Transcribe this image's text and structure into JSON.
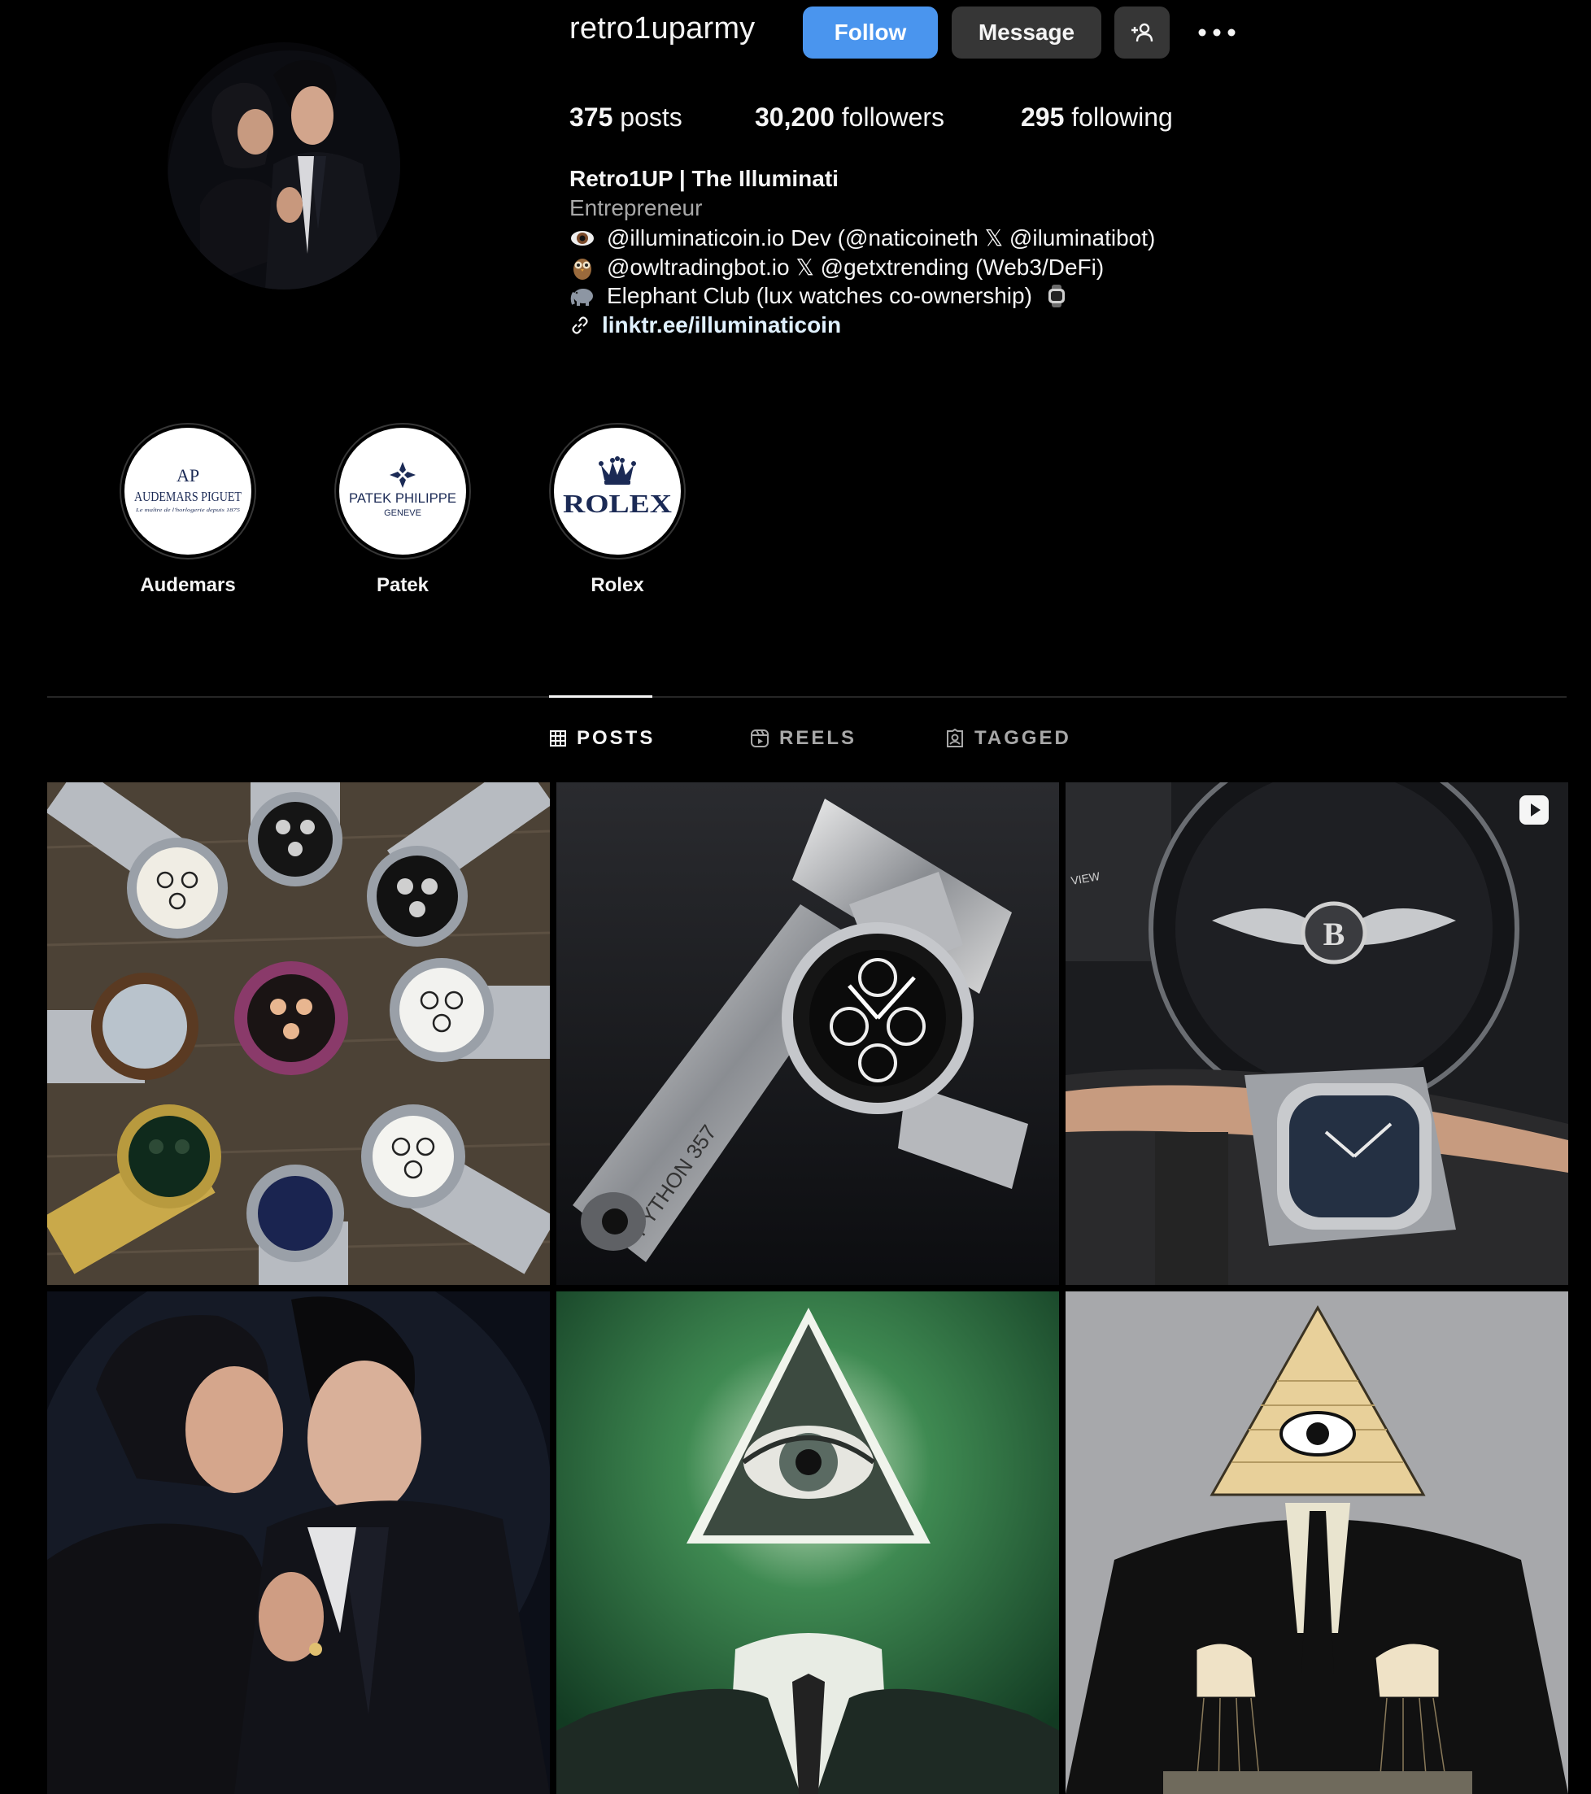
{
  "profile": {
    "username": "retro1uparmy",
    "follow_label": "Follow",
    "message_label": "Message",
    "stats": {
      "posts_count": "375",
      "posts_label": "posts",
      "followers_count": "30,200",
      "followers_label": "followers",
      "following_count": "295",
      "following_label": "following"
    },
    "bio": {
      "name": "Retro1UP | The Illuminati",
      "category": "Entrepreneur",
      "line1": "@illuminaticoin.io Dev (@naticoineth 𝕏 @iluminatibot)",
      "line2": "@owltradingbot.io 𝕏 @getxtrending (Web3/DeFi)",
      "line3": "Elephant Club (lux watches co-ownership)",
      "link": "linktr.ee/illuminaticoin"
    }
  },
  "highlights": [
    {
      "label": "Audemars",
      "logo_text": "AUDEMARS PIGUET",
      "logo_mark": "AP",
      "logo_sub": "Le maître de l'horlogerie depuis 1875"
    },
    {
      "label": "Patek",
      "logo_text": "PATEK PHILIPPE",
      "logo_sub": "GENEVE"
    },
    {
      "label": "Rolex",
      "logo_text": "ROLEX"
    }
  ],
  "tabs": [
    {
      "label": "POSTS",
      "icon": "grid-icon",
      "active": true
    },
    {
      "label": "REELS",
      "icon": "reels-icon",
      "active": false
    },
    {
      "label": "TAGGED",
      "icon": "tagged-icon",
      "active": false
    }
  ],
  "posts": {
    "post2_engraving": "PYTHON 357",
    "post3_dash_text": "VIEW"
  },
  "colors": {
    "background": "#000000",
    "follow_button": "#4a95ee",
    "secondary_button": "#363636",
    "link": "#e0f1ff",
    "muted_text": "#a8a8a8"
  }
}
